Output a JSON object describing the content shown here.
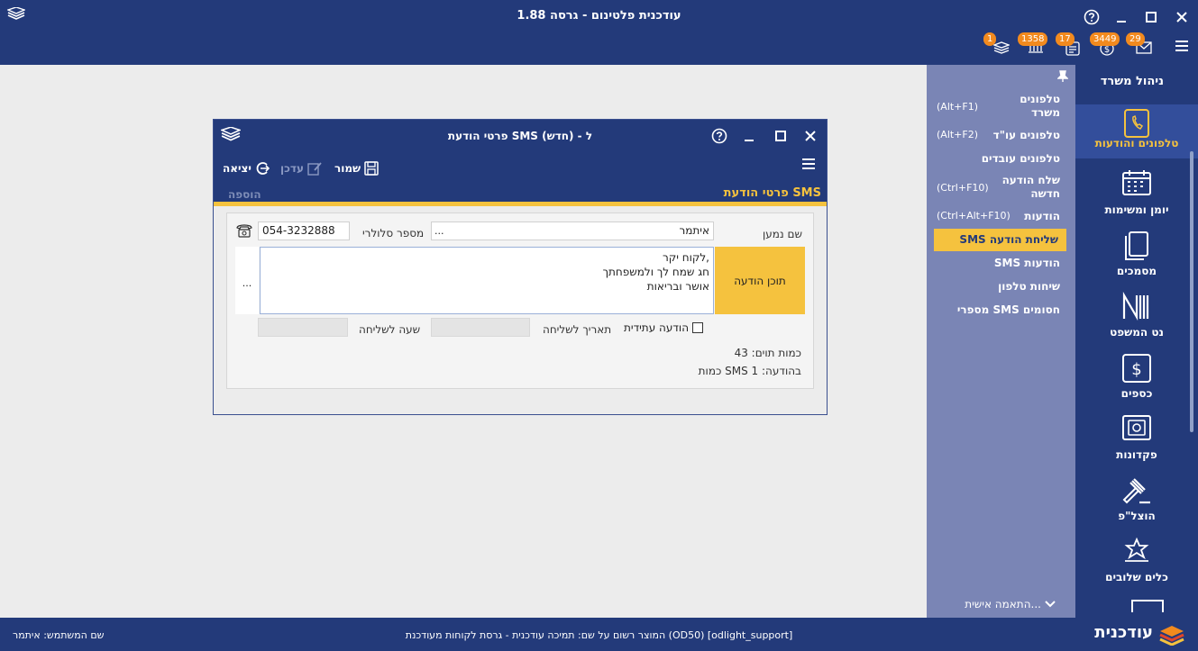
{
  "app": {
    "title": "עודכנית פלטינום - גרסה 1.88",
    "toolbar_badges": [
      "1",
      "1358",
      "17",
      "3449",
      "29"
    ]
  },
  "sidebar": {
    "title": "ניהול משרד",
    "items": [
      {
        "label": "טלפונים והודעות",
        "icon": "phone-icon",
        "active": true
      },
      {
        "label": "יומן ומשימות",
        "icon": "calendar-icon"
      },
      {
        "label": "מסמכים",
        "icon": "documents-icon"
      },
      {
        "label": "נט המשפט",
        "icon": "net-hamishpat-icon"
      },
      {
        "label": "כספים",
        "icon": "money-icon"
      },
      {
        "label": "פקדונות",
        "icon": "safe-icon"
      },
      {
        "label": "הוצל\"פ",
        "icon": "gavel-icon"
      },
      {
        "label": "כלים שלובים",
        "icon": "tools-icon"
      }
    ]
  },
  "submenu": {
    "items": [
      {
        "label": "טלפונים משרד",
        "shortcut": "(Alt+F1)"
      },
      {
        "label": "טלפונים עו\"ד",
        "shortcut": "(Alt+F2)"
      },
      {
        "label": "טלפונים עובדים",
        "shortcut": ""
      },
      {
        "label": "שלח הודעה חדשה",
        "shortcut": "(Ctrl+F10)"
      },
      {
        "label": "הודעות",
        "shortcut": "(Ctrl+Alt+F10)"
      },
      {
        "label": "SMS שליחת הודעה",
        "shortcut": "",
        "active": true
      },
      {
        "label": "SMS הודעות",
        "shortcut": ""
      },
      {
        "label": "שיחות טלפון",
        "shortcut": ""
      },
      {
        "label": "מספרי SMS חסומים",
        "shortcut": ""
      }
    ],
    "personalize": "התאמה אישית..."
  },
  "dialog": {
    "title": "פרטי הודעת SMS ל - (חדש)",
    "actions": {
      "save": "שמור",
      "update": "עדכן",
      "exit": "יציאה"
    },
    "header_title": "פרטי הודעת SMS",
    "header_add": "הוספה",
    "form": {
      "recipient_label": "שם נמען",
      "recipient_value": "איתמר",
      "recipient_more": "...",
      "phone_label": "מספר סלולרי",
      "phone_value": "054-3232888",
      "content_label": "תוכן הודעה",
      "content_lines": [
        "לקוח יקר,",
        "חג שמח לך ולמשפחתך",
        "אושר ובריאות"
      ],
      "content_more": "...",
      "future_label": "הודעה עתידית",
      "send_date_label": "תאריך לשליחה",
      "send_time_label": "שעה לשליחה",
      "char_count": "כמות תוים: 43",
      "sms_count": "כמות SMS בהודעה:  1"
    }
  },
  "statusbar": {
    "logo_text": "עודכנית",
    "registered": "המוצר רשום על שם: תמיכה עודכנית - גרסת לקוחות מעודכנת (OD50) [odlight_support]",
    "user": "שם המשתמש: איתמר"
  }
}
